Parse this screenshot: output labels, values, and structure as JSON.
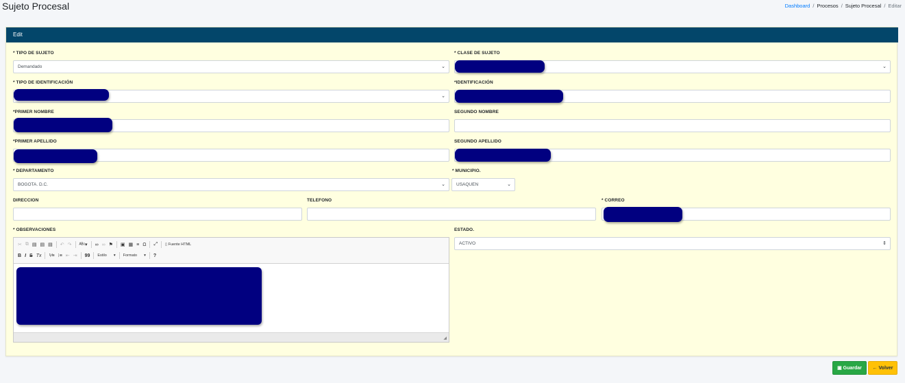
{
  "header": {
    "title": "Sujeto Procesal",
    "breadcrumb": [
      "Dashboard",
      "Procesos",
      "Sujeto Procesal",
      "Editar"
    ],
    "separator": "/"
  },
  "card": {
    "title": "Edit",
    "header_color": "#03466a",
    "background_color": "#ffffe0"
  },
  "form": {
    "tipo_sujeto": {
      "label": "* TIPO DE SUJETO",
      "value": "Demandado"
    },
    "clase_sujeto": {
      "label": "* CLASE DE SUJETO",
      "value": ""
    },
    "tipo_identificacion": {
      "label": "* TIPO DE IDENTIFICACIÓN",
      "value": ""
    },
    "identificacion": {
      "label": "*IDENTIFICACIÓN",
      "value": ""
    },
    "primer_nombre": {
      "label": "*PRIMER NOMBRE",
      "value": ""
    },
    "segundo_nombre": {
      "label": "SEGUNDO NOMBRE",
      "value": ""
    },
    "primer_apellido": {
      "label": "*PRIMER APELLIDO",
      "value": ""
    },
    "segundo_apellido": {
      "label": "SEGUNDO APELLIDO",
      "value": ""
    },
    "departamento": {
      "label": "* DEPARTAMENTO",
      "value": "BOGOTA. D.C."
    },
    "municipio": {
      "label": "* MUNICIPIO.",
      "value": "USAQUEN"
    },
    "direccion": {
      "label": "DIRECCION",
      "value": ""
    },
    "telefono": {
      "label": "TELEFONO",
      "value": ""
    },
    "correo": {
      "label": "* CORREO",
      "value": ""
    },
    "observaciones": {
      "label": "* OBSERVACIONES"
    },
    "estado": {
      "label": "ESTADO.",
      "value": "ACTIVO"
    }
  },
  "editor_toolbar": {
    "source_label": "Fuente HTML",
    "style_label": "Estilo",
    "format_label": "Formato",
    "help_label": "?",
    "bold": "B",
    "italic": "I",
    "strike": "S",
    "clear_format": "Tx",
    "blockquote": "99"
  },
  "icons": {
    "cut": "scissors-icon",
    "copy": "copy-icon",
    "paste": "paste-icon",
    "undo": "undo-icon",
    "redo": "redo-icon",
    "spellcheck": "spellcheck-icon",
    "link": "link-icon",
    "unlink": "unlink-icon",
    "anchor": "flag-icon",
    "image": "image-icon",
    "table": "table-icon",
    "hr": "horizontal-rule-icon",
    "special_char": "omega-icon",
    "maximize": "maximize-icon"
  },
  "buttons": {
    "guardar": "Guardar",
    "volver": "Volver"
  },
  "colors": {
    "link": "#007bff",
    "save": "#28a745",
    "back": "#ffc107",
    "redaction": "#010080"
  }
}
